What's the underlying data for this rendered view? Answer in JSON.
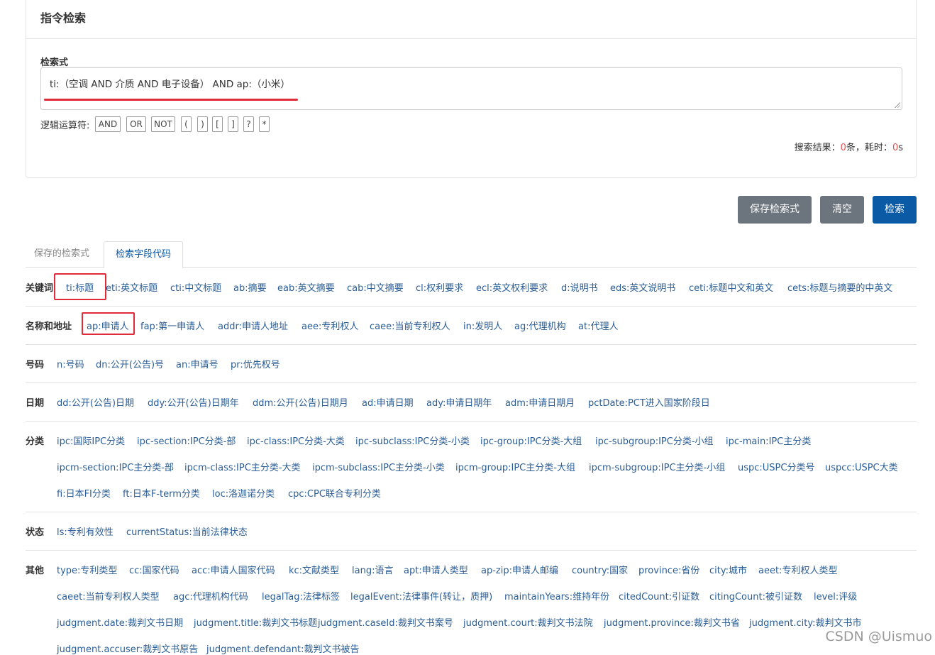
{
  "panel": {
    "title": "指令检索",
    "query_label": "检索式",
    "query_value": "ti:（空调 AND 介质 AND 电子设备） AND ap:（小米）",
    "ops_label": "逻辑运算符:",
    "ops": [
      "AND",
      "OR",
      "NOT",
      "(",
      ")",
      "[",
      "]",
      "?",
      "*"
    ],
    "result_prefix": "搜索结果：",
    "result_count": "0",
    "result_mid": "条，耗时：",
    "result_time": "0",
    "result_suffix": "s"
  },
  "buttons": {
    "save": "保存检索式",
    "clear": "清空",
    "search": "检索"
  },
  "tabs": [
    "保存的检索式",
    "检索字段代码"
  ],
  "sections": {
    "keywords": {
      "label": "关键词",
      "items": [
        "ti:标题",
        "eti:英文标题",
        "cti:中文标题",
        "ab:摘要",
        "eab:英文摘要",
        "cab:中文摘要",
        "cl:权利要求",
        "ecl:英文权利要求",
        "d:说明书",
        "eds:英文说明书",
        "ceti:标题中文和英文",
        "cets:标题与摘要的中英文"
      ]
    },
    "name": {
      "label": "名称和地址",
      "items": [
        "ap:申请人",
        "fap:第一申请人",
        "addr:申请人地址",
        "aee:专利权人",
        "caee:当前专利权人",
        "in:发明人",
        "ag:代理机构",
        "at:代理人"
      ]
    },
    "number": {
      "label": "号码",
      "items": [
        "n:号码",
        "dn:公开(公告)号",
        "an:申请号",
        "pr:优先权号"
      ]
    },
    "date": {
      "label": "日期",
      "items": [
        "dd:公开(公告)日期",
        "ddy:公开(公告)日期年",
        "ddm:公开(公告)日期月",
        "ad:申请日期",
        "ady:申请日期年",
        "adm:申请日期月",
        "pctDate:PCT进入国家阶段日"
      ]
    },
    "class": {
      "label": "分类",
      "row1": [
        "ipc:国际IPC分类",
        "ipc-section:IPC分类-部",
        "ipc-class:IPC分类-大类",
        "ipc-subclass:IPC分类-小类",
        "ipc-group:IPC分类-大组",
        "ipc-subgroup:IPC分类-小组",
        "ipc-main:IPC主分类"
      ],
      "row2": [
        "ipcm-section:IPC主分类-部",
        "ipcm-class:IPC主分类-大类",
        "ipcm-subclass:IPC主分类-小类",
        "ipcm-group:IPC主分类-大组",
        "ipcm-subgroup:IPC主分类-小组",
        "uspc:USPC分类号",
        "uspcc:USPC大类"
      ],
      "row3": [
        "fi:日本FI分类",
        "ft:日本F-term分类",
        "loc:洛迦诺分类",
        "cpc:CPC联合专利分类"
      ]
    },
    "status": {
      "label": "状态",
      "items": [
        "ls:专利有效性",
        "currentStatus:当前法律状态"
      ]
    },
    "other": {
      "label": "其他",
      "row1": [
        "type:专利类型",
        "cc:国家代码",
        "acc:申请人国家代码",
        "kc:文献类型",
        "lang:语言",
        "apt:申请人类型",
        "ap-zip:申请人邮编",
        "country:国家",
        "province:省份",
        "city:城市",
        "aeet:专利权人类型"
      ],
      "row2": [
        "caeet:当前专利权人类型",
        "agc:代理机构代码",
        "legalTag:法律标签",
        "legalEvent:法律事件(转让，质押)",
        "maintainYears:维持年份",
        "citedCount:引证数",
        "citingCount:被引证数",
        "level:评级"
      ],
      "row3": [
        "judgment.date:裁判文书日期",
        "judgment.title:裁判文书标题",
        "judgment.caseId:裁判文书案号",
        "judgment.court:裁判文书法院",
        "judgment.province:裁判文书省",
        "judgment.city:裁判文书市"
      ],
      "row4": [
        "judgment.accuser:裁判文书原告",
        "judgment.defendant:裁判文书被告"
      ]
    }
  },
  "watermark": "CSDN @Uismuo"
}
